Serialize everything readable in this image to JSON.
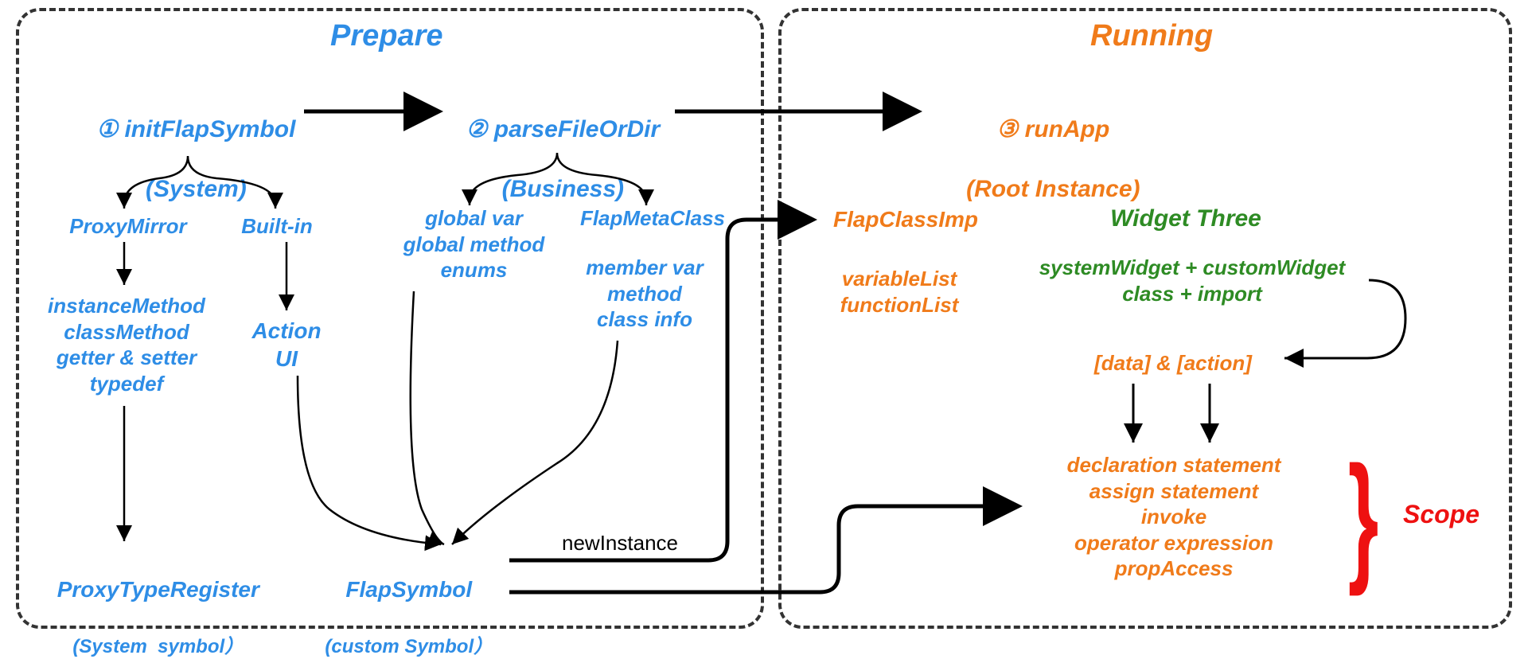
{
  "panels": {
    "prepare": {
      "title": "Prepare"
    },
    "running": {
      "title": "Running"
    }
  },
  "steps": {
    "s1": {
      "num": "①",
      "name": "initFlapSymbol",
      "sub": "(System)"
    },
    "s2": {
      "num": "②",
      "name": "parseFileOrDir",
      "sub": "(Business)"
    },
    "s3": {
      "num": "③",
      "name": "runApp",
      "sub": "(Root Instance)"
    }
  },
  "prepare": {
    "proxyMirror": "ProxyMirror",
    "builtIn": "Built-in",
    "instanceBlock": "instanceMethod\nclassMethod\ngetter & setter\ntypedef",
    "actionUI": "Action\nUI",
    "globalVar": "global var\nglobal method\nenums",
    "flapMetaClass": "FlapMetaClass",
    "memberVar": "member var\nmethod\nclass info",
    "proxyTypeRegister": "ProxyTypeRegister",
    "proxyTypeRegisterSub": "(System  symbol）",
    "flapSymbol": "FlapSymbol",
    "flapSymbolSub": "(custom Symbol）",
    "newInstance": "newInstance"
  },
  "running": {
    "flapClassImp": "FlapClassImp",
    "varFuncList": "variableList\nfunctionList",
    "widgetThree": "Widget Three",
    "widgetDetails": "systemWidget + customWidget\nclass + import",
    "dataAction": "[data] & [action]",
    "statements": "declaration statement\nassign statement\ninvoke\noperator expression\npropAccess",
    "scope": "Scope"
  }
}
